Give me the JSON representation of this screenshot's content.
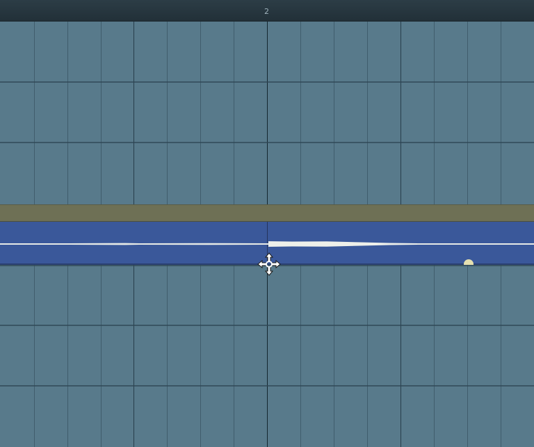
{
  "ruler": {
    "bar_label": "2"
  },
  "timeline": {
    "track_strip_color": "#6e7055",
    "clip_color": "#3a589a",
    "grid_color": "#587a8b"
  },
  "icons": {
    "cursor": "move-cursor-icon",
    "fade": "fade-handle-icon"
  }
}
